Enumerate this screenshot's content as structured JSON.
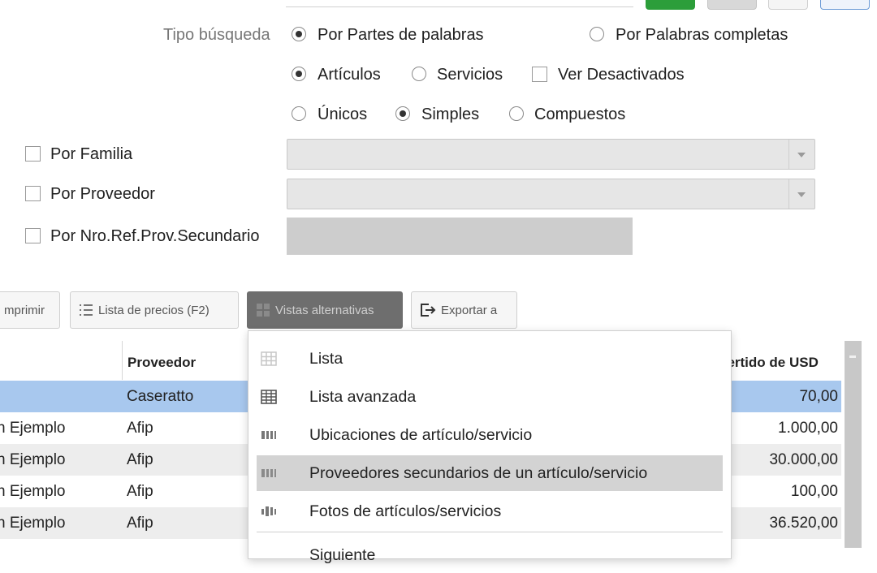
{
  "search": {
    "tipo_label": "Tipo búsqueda",
    "partes_label": "Por Partes de palabras",
    "completas_label": "Por Palabras completas",
    "articulos_label": "Artículos",
    "servicios_label": "Servicios",
    "desactivados_label": "Ver Desactivados",
    "unicos_label": "Únicos",
    "simples_label": "Simples",
    "compuestos_label": "Compuestos"
  },
  "filters": {
    "familia_label": "Por Familia",
    "proveedor_label": "Por Proveedor",
    "nro_ref_label": "Por Nro.Ref.Prov.Secundario"
  },
  "toolbar": {
    "imprimir_label": "mprimir",
    "lista_precios_label": "Lista de precios (F2)",
    "vistas_label": "Vistas alternativas",
    "exportar_label": "Exportar a"
  },
  "table": {
    "headers": {
      "proveedor": "Proveedor",
      "convertido": "vertido de USD"
    },
    "rows": [
      {
        "descripcion": "",
        "proveedor": "Caseratto",
        "valor": "70,00"
      },
      {
        "descripcion": "n Ejemplo",
        "proveedor": "Afip",
        "valor": "1.000,00"
      },
      {
        "descripcion": "n Ejemplo",
        "proveedor": "Afip",
        "valor": "30.000,00"
      },
      {
        "descripcion": "n Ejemplo",
        "proveedor": "Afip",
        "valor": "100,00"
      },
      {
        "descripcion": "n Ejemplo",
        "proveedor": "Afip",
        "valor": "36.520,00"
      }
    ]
  },
  "menu": {
    "items": [
      {
        "label": "Lista",
        "icon": "grid-icon"
      },
      {
        "label": "Lista avanzada",
        "icon": "advanced-grid-icon"
      },
      {
        "label": "Ubicaciones de artículo/servicio",
        "icon": "location-icon"
      },
      {
        "label": "Proveedores secundarios de un artículo/servicio",
        "icon": "suppliers-icon"
      },
      {
        "label": "Fotos de artículos/servicios",
        "icon": "photos-icon"
      },
      {
        "label": "Siguiente",
        "icon": ""
      }
    ]
  },
  "colors": {
    "selected_row": "#a8c8ee",
    "alt_row": "#ededed",
    "green_button": "#2c9e3a",
    "active_toolbar": "#6e6e6e",
    "menu_highlight": "#d3d3d3"
  }
}
